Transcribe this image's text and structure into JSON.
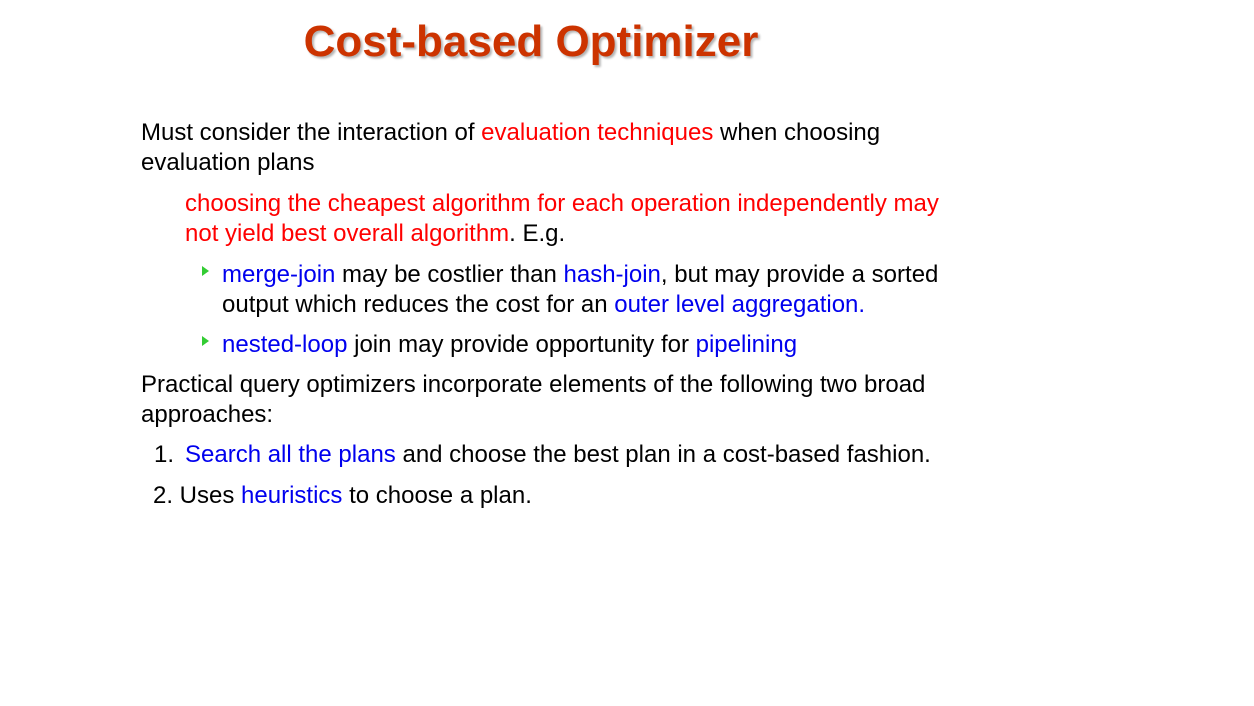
{
  "slide": {
    "title": "Cost-based Optimizer",
    "p1": {
      "a": "Must consider the interaction of ",
      "b": "evaluation techniques",
      "c": " when choosing evaluation plans"
    },
    "p2": {
      "a": "choosing the cheapest algorithm for each operation independently may not yield best overall algorithm",
      "b": ".  E.g."
    },
    "b1": {
      "a": "merge-join",
      "b": " may be costlier than ",
      "c": "hash-join",
      "d": ", but may provide a sorted output which reduces the cost for an ",
      "e": "outer level aggregation."
    },
    "b2": {
      "a": "nested-loop",
      "b": " join may provide opportunity for ",
      "c": "pipelining"
    },
    "p3": "Practical query optimizers incorporate elements of the following two broad approaches:",
    "n1": {
      "marker": "1.",
      "a": "Search all the plans",
      "b": " and choose the best plan in a cost-based fashion."
    },
    "n2": {
      "a": "2. Uses ",
      "b": "heuristics",
      "c": " to choose a plan."
    }
  },
  "colors": {
    "title": "#cc3300",
    "emphasis_red": "#ff0000",
    "emphasis_blue": "#0000ee",
    "bullet": "#33cc33"
  }
}
